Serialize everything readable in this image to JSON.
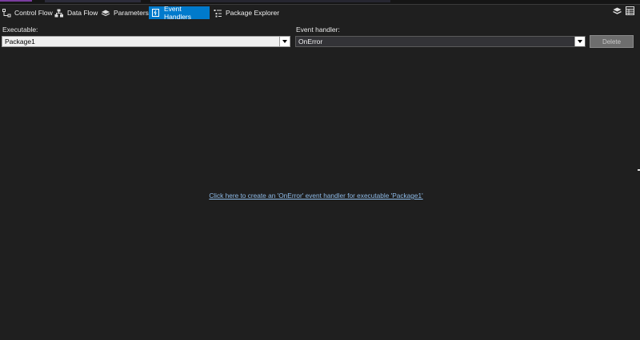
{
  "tabs": [
    {
      "label": "Control Flow",
      "icon": "control-flow-icon",
      "active": false
    },
    {
      "label": "Data Flow",
      "icon": "data-flow-icon",
      "active": false
    },
    {
      "label": "Parameters",
      "icon": "parameters-icon",
      "active": false
    },
    {
      "label": "Event Handlers",
      "icon": "event-handlers-icon",
      "active": true
    },
    {
      "label": "Package Explorer",
      "icon": "package-explorer-icon",
      "active": false
    }
  ],
  "toolbar_right": [
    "variables-icon",
    "grid-icon"
  ],
  "executable": {
    "label": "Executable:",
    "value": "Package1"
  },
  "event_handler": {
    "label": "Event handler:",
    "value": "OnError"
  },
  "delete_button": {
    "label": "Delete",
    "enabled": false
  },
  "create_link": "Click here to create an 'OnError' event handler for executable 'Package1'",
  "colors": {
    "background": "#1f1f1f",
    "active_tab": "#007acc",
    "link": "#8ebbe8",
    "disabled_button": "#6e6e6e"
  }
}
